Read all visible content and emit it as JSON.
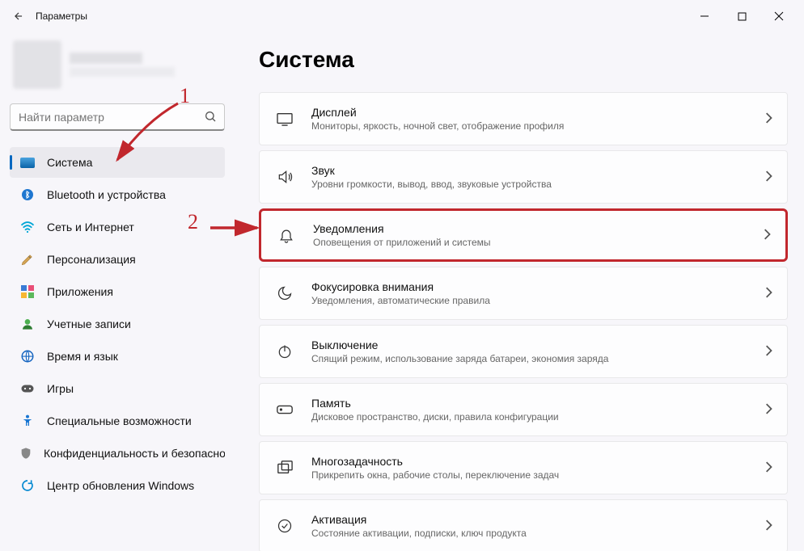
{
  "window": {
    "title": "Параметры"
  },
  "search": {
    "placeholder": "Найти параметр"
  },
  "sidebar": {
    "items": [
      {
        "label": "Система"
      },
      {
        "label": "Bluetooth и устройства"
      },
      {
        "label": "Сеть и Интернет"
      },
      {
        "label": "Персонализация"
      },
      {
        "label": "Приложения"
      },
      {
        "label": "Учетные записи"
      },
      {
        "label": "Время и язык"
      },
      {
        "label": "Игры"
      },
      {
        "label": "Специальные возможности"
      },
      {
        "label": "Конфиденциальность и безопасность"
      },
      {
        "label": "Центр обновления Windows"
      }
    ]
  },
  "main": {
    "heading": "Система",
    "cards": [
      {
        "title": "Дисплей",
        "subtitle": "Мониторы, яркость, ночной свет, отображение профиля"
      },
      {
        "title": "Звук",
        "subtitle": "Уровни громкости, вывод, ввод, звуковые устройства"
      },
      {
        "title": "Уведомления",
        "subtitle": "Оповещения от приложений и системы"
      },
      {
        "title": "Фокусировка внимания",
        "subtitle": "Уведомления, автоматические правила"
      },
      {
        "title": "Выключение",
        "subtitle": "Спящий режим, использование заряда батареи, экономия заряда"
      },
      {
        "title": "Память",
        "subtitle": "Дисковое пространство, диски, правила конфигурации"
      },
      {
        "title": "Многозадачность",
        "subtitle": "Прикрепить окна, рабочие столы, переключение задач"
      },
      {
        "title": "Активация",
        "subtitle": "Состояние активации, подписки, ключ продукта"
      }
    ]
  },
  "annotations": {
    "one": "1",
    "two": "2"
  }
}
